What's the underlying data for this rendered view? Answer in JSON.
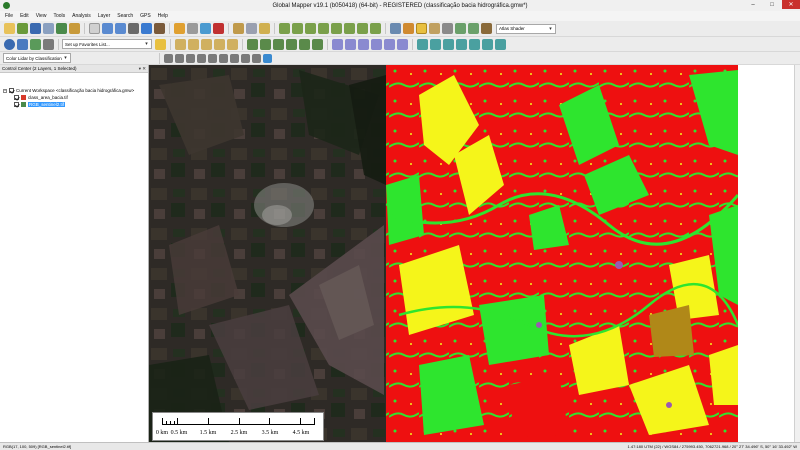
{
  "window": {
    "title": "Global Mapper v19.1 (b050418) (64-bit) - REGISTERED (classificação bacia hidrográfica.gmw*)",
    "minimize": "–",
    "maximize": "□",
    "close": "✕"
  },
  "menu": [
    "File",
    "Edit",
    "View",
    "Tools",
    "Analysis",
    "Layer",
    "Search",
    "GPS",
    "Help"
  ],
  "toolbar": {
    "shader_select": "Atlas Shader",
    "favorites_select": "Set up Favorites List...",
    "lidar_select": "Color Lidar by Classification"
  },
  "control_center": {
    "header": "Control Center (2 Layers, 1 Selected)",
    "header_buttons": "▾ ✕",
    "workspace": "Current Workspace <classificação bacia hidrográfica.gmw>",
    "layers": [
      {
        "label": "class_area_bacia.tif",
        "checked": true,
        "selected": false
      },
      {
        "label": "RGB_sentinel2.tif",
        "checked": true,
        "selected": true
      }
    ]
  },
  "scalebar": {
    "labels": [
      "0 km",
      "0.5 km",
      "1.5 km",
      "2.5 km",
      "3.5 km",
      "4.5 km"
    ]
  },
  "status": {
    "left": "RGB(17, 100, 509) [RGB_sentinel2.tif]",
    "right": "1.47:180 UTM (22) / WGS84 / 275993.450, 7062721.968 / 20° 27' 34.496\" S, 50° 16' 33.492\" W"
  },
  "colors": {
    "class_red": "#ee1010",
    "class_green": "#2ee52e",
    "class_yellow": "#f5f51a",
    "class_brown": "#b08818",
    "class_purple": "#9a5ab0"
  }
}
